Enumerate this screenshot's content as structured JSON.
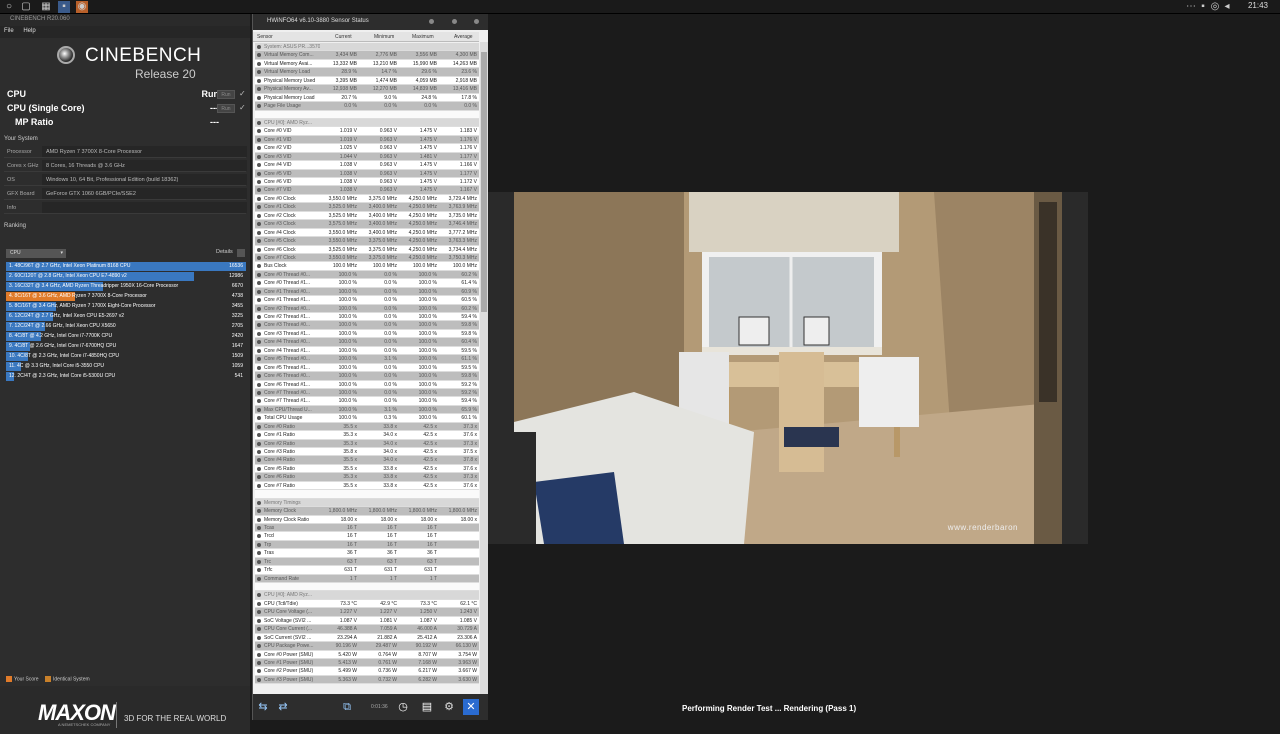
{
  "taskbar": {
    "time": "21:43"
  },
  "cinebench": {
    "window_title": "CINEBENCH R20.060",
    "menu": [
      "File",
      "Help"
    ],
    "logo_word": "CINEBENCH",
    "release": "Release 20",
    "tests": [
      {
        "label": "CPU",
        "value": "Run",
        "button": "Run"
      },
      {
        "label": "CPU (Single Core)",
        "value": "---",
        "button": "Run"
      },
      {
        "label": "MP Ratio",
        "value": "---"
      }
    ],
    "your_system_title": "Your System",
    "system": [
      {
        "key": "Processor",
        "value": "AMD Ryzen 7 3700X 8-Core Processor"
      },
      {
        "key": "Cores x GHz",
        "value": "8 Cores, 16 Threads @ 3.6 GHz"
      },
      {
        "key": "OS",
        "value": "Windows 10, 64 Bit, Professional Edition (build 18362)"
      },
      {
        "key": "GFX Board",
        "value": "GeForce GTX 1060 6GB/PCIe/SSE2"
      },
      {
        "key": "Info",
        "value": ""
      }
    ],
    "ranking_title": "Ranking",
    "ranking_select": "CPU",
    "details_label": "Details",
    "ranking": [
      {
        "label": "1. 48C/96T @ 2.7 GHz, Intel Xeon Platinum 8168 CPU",
        "score": "16536",
        "pct": 1.0,
        "kind": "other"
      },
      {
        "label": "2. 60C/120T @ 2.8 GHz, Intel Xeon CPU E7-4890 v2",
        "score": "12986",
        "pct": 0.785,
        "kind": "other"
      },
      {
        "label": "3. 16C/32T @ 3.4 GHz, AMD Ryzen Threadripper 1950X 16-Core Processor",
        "score": "6670",
        "pct": 0.403,
        "kind": "other"
      },
      {
        "label": "4. 8C/16T @ 3.6 GHz, AMD Ryzen 7 3700X 8-Core Processor",
        "score": "4738",
        "pct": 0.287,
        "kind": "mine"
      },
      {
        "label": "5. 8C/16T @ 3.4 GHz, AMD Ryzen 7 1700X Eight-Core Processor",
        "score": "3455",
        "pct": 0.209,
        "kind": "other"
      },
      {
        "label": "6. 12C/24T @ 2.7 GHz, Intel Xeon CPU E5-2697 v2",
        "score": "3225",
        "pct": 0.195,
        "kind": "other"
      },
      {
        "label": "7. 12C/24T @ 2.66 GHz, Intel Xeon CPU X5650",
        "score": "2705",
        "pct": 0.164,
        "kind": "other"
      },
      {
        "label": "8. 4C/8T @ 4.2 GHz, Intel Core i7-7700K CPU",
        "score": "2420",
        "pct": 0.146,
        "kind": "other"
      },
      {
        "label": "9. 4C/8T @ 2.6 GHz, Intel Core i7-6700HQ CPU",
        "score": "1647",
        "pct": 0.1,
        "kind": "other"
      },
      {
        "label": "10. 4C/8T @ 2.3 GHz, Intel Core i7-4850HQ CPU",
        "score": "1509",
        "pct": 0.091,
        "kind": "other"
      },
      {
        "label": "11. 4C @ 3.3 GHz, Intel Core i5-3550 CPU",
        "score": "1059",
        "pct": 0.064,
        "kind": "other"
      },
      {
        "label": "12. 2C/4T @ 2.3 GHz, Intel Core i5-5300U CPU",
        "score": "541",
        "pct": 0.033,
        "kind": "other"
      }
    ],
    "legend": [
      "Your Score",
      "Identical System"
    ],
    "maxon": "MAXON",
    "maxon_sub": "A NEMETSCHEK COMPANY",
    "tagline": "3D FOR THE REAL WORLD",
    "colors": {
      "mine": "#e07b2a",
      "other": "#3a78c0",
      "identical": "#c8802a"
    }
  },
  "hwinfo": {
    "title": "HWiNFO64 v6.10-3880 Sensor Status",
    "columns": [
      "Sensor",
      "Current",
      "Minimum",
      "Maximum",
      "Average"
    ],
    "rows": [
      {
        "n": "System: ASUS PR...3570",
        "c": [
          "",
          "",
          "",
          ""
        ],
        "t": "grp"
      },
      {
        "n": "Virtual Memory Com...",
        "c": [
          "3,434 MB",
          "2,776 MB",
          "3,556 MB",
          "4,300 MB"
        ],
        "t": "alt"
      },
      {
        "n": "Virtual Memory Avai...",
        "c": [
          "13,332 MB",
          "13,210 MB",
          "15,990 MB",
          "14,263 MB"
        ]
      },
      {
        "n": "Virtual Memory Load",
        "c": [
          "28.9 %",
          "14.7 %",
          "29.6 %",
          "23.6 %"
        ],
        "t": "alt"
      },
      {
        "n": "Physical Memory Used",
        "c": [
          "3,395 MB",
          "1,474 MB",
          "4,059 MB",
          "2,918 MB"
        ]
      },
      {
        "n": "Physical Memory Av...",
        "c": [
          "12,938 MB",
          "12,270 MB",
          "14,839 MB",
          "13,416 MB"
        ],
        "t": "alt"
      },
      {
        "n": "Physical Memory Load",
        "c": [
          "20.7 %",
          "9.0 %",
          "24.8 %",
          "17.8 %"
        ]
      },
      {
        "n": "Page File Usage",
        "c": [
          "0.0 %",
          "0.0 %",
          "0.0 %",
          "0.0 %"
        ],
        "t": "alt"
      },
      {
        "n": "",
        "c": [
          "",
          "",
          "",
          ""
        ],
        "t": "gap"
      },
      {
        "n": "CPU [#0]: AMD Ryz...",
        "c": [
          "",
          "",
          "",
          ""
        ],
        "t": "grp"
      },
      {
        "n": "Core #0 VID",
        "c": [
          "1.019 V",
          "0.963 V",
          "1.475 V",
          "1.183 V"
        ]
      },
      {
        "n": "Core #1 VID",
        "c": [
          "1.019 V",
          "0.963 V",
          "1.475 V",
          "1.176 V"
        ],
        "t": "alt"
      },
      {
        "n": "Core #2 VID",
        "c": [
          "1.025 V",
          "0.963 V",
          "1.475 V",
          "1.176 V"
        ]
      },
      {
        "n": "Core #3 VID",
        "c": [
          "1.044 V",
          "0.963 V",
          "1.481 V",
          "1.177 V"
        ],
        "t": "alt"
      },
      {
        "n": "Core #4 VID",
        "c": [
          "1.038 V",
          "0.963 V",
          "1.475 V",
          "1.166 V"
        ]
      },
      {
        "n": "Core #5 VID",
        "c": [
          "1.038 V",
          "0.963 V",
          "1.475 V",
          "1.177 V"
        ],
        "t": "alt"
      },
      {
        "n": "Core #6 VID",
        "c": [
          "1.038 V",
          "0.963 V",
          "1.475 V",
          "1.172 V"
        ]
      },
      {
        "n": "Core #7 VID",
        "c": [
          "1.038 V",
          "0.963 V",
          "1.475 V",
          "1.167 V"
        ],
        "t": "alt"
      },
      {
        "n": "Core #0 Clock",
        "c": [
          "3,550.0 MHz",
          "3,375.0 MHz",
          "4,250.0 MHz",
          "3,729.4 MHz"
        ]
      },
      {
        "n": "Core #1 Clock",
        "c": [
          "3,525.0 MHz",
          "3,400.0 MHz",
          "4,250.0 MHz",
          "3,763.9 MHz"
        ],
        "t": "alt"
      },
      {
        "n": "Core #2 Clock",
        "c": [
          "3,525.0 MHz",
          "3,400.0 MHz",
          "4,250.0 MHz",
          "3,735.0 MHz"
        ]
      },
      {
        "n": "Core #3 Clock",
        "c": [
          "3,575.0 MHz",
          "3,400.0 MHz",
          "4,250.0 MHz",
          "3,746.4 MHz"
        ],
        "t": "alt"
      },
      {
        "n": "Core #4 Clock",
        "c": [
          "3,550.0 MHz",
          "3,400.0 MHz",
          "4,250.0 MHz",
          "3,777.2 MHz"
        ]
      },
      {
        "n": "Core #5 Clock",
        "c": [
          "3,550.0 MHz",
          "3,375.0 MHz",
          "4,250.0 MHz",
          "3,763.3 MHz"
        ],
        "t": "alt"
      },
      {
        "n": "Core #6 Clock",
        "c": [
          "3,525.0 MHz",
          "3,375.0 MHz",
          "4,250.0 MHz",
          "3,734.4 MHz"
        ]
      },
      {
        "n": "Core #7 Clock",
        "c": [
          "3,550.0 MHz",
          "3,375.0 MHz",
          "4,250.0 MHz",
          "3,750.3 MHz"
        ],
        "t": "alt"
      },
      {
        "n": "Bus Clock",
        "c": [
          "100.0 MHz",
          "100.0 MHz",
          "100.0 MHz",
          "100.0 MHz"
        ]
      },
      {
        "n": "Core #0 Thread #0...",
        "c": [
          "100.0 %",
          "0.0 %",
          "100.0 %",
          "60.2 %"
        ],
        "t": "alt"
      },
      {
        "n": "Core #0 Thread #1...",
        "c": [
          "100.0 %",
          "0.0 %",
          "100.0 %",
          "61.4 %"
        ]
      },
      {
        "n": "Core #1 Thread #0...",
        "c": [
          "100.0 %",
          "0.0 %",
          "100.0 %",
          "60.9 %"
        ],
        "t": "alt"
      },
      {
        "n": "Core #1 Thread #1...",
        "c": [
          "100.0 %",
          "0.0 %",
          "100.0 %",
          "60.5 %"
        ]
      },
      {
        "n": "Core #2 Thread #0...",
        "c": [
          "100.0 %",
          "0.0 %",
          "100.0 %",
          "60.2 %"
        ],
        "t": "alt"
      },
      {
        "n": "Core #2 Thread #1...",
        "c": [
          "100.0 %",
          "0.0 %",
          "100.0 %",
          "59.4 %"
        ]
      },
      {
        "n": "Core #3 Thread #0...",
        "c": [
          "100.0 %",
          "0.0 %",
          "100.0 %",
          "59.8 %"
        ],
        "t": "alt"
      },
      {
        "n": "Core #3 Thread #1...",
        "c": [
          "100.0 %",
          "0.0 %",
          "100.0 %",
          "59.8 %"
        ]
      },
      {
        "n": "Core #4 Thread #0...",
        "c": [
          "100.0 %",
          "0.0 %",
          "100.0 %",
          "60.4 %"
        ],
        "t": "alt"
      },
      {
        "n": "Core #4 Thread #1...",
        "c": [
          "100.0 %",
          "0.0 %",
          "100.0 %",
          "59.5 %"
        ]
      },
      {
        "n": "Core #5 Thread #0...",
        "c": [
          "100.0 %",
          "3.1 %",
          "100.0 %",
          "61.1 %"
        ],
        "t": "alt"
      },
      {
        "n": "Core #5 Thread #1...",
        "c": [
          "100.0 %",
          "0.0 %",
          "100.0 %",
          "59.5 %"
        ]
      },
      {
        "n": "Core #6 Thread #0...",
        "c": [
          "100.0 %",
          "0.0 %",
          "100.0 %",
          "59.8 %"
        ],
        "t": "alt"
      },
      {
        "n": "Core #6 Thread #1...",
        "c": [
          "100.0 %",
          "0.0 %",
          "100.0 %",
          "59.2 %"
        ]
      },
      {
        "n": "Core #7 Thread #0...",
        "c": [
          "100.0 %",
          "0.0 %",
          "100.0 %",
          "59.2 %"
        ],
        "t": "alt"
      },
      {
        "n": "Core #7 Thread #1...",
        "c": [
          "100.0 %",
          "0.0 %",
          "100.0 %",
          "59.4 %"
        ]
      },
      {
        "n": "Max CPU/Thread U...",
        "c": [
          "100.0 %",
          "3.1 %",
          "100.0 %",
          "65.9 %"
        ],
        "t": "alt"
      },
      {
        "n": "Total CPU Usage",
        "c": [
          "100.0 %",
          "0.3 %",
          "100.0 %",
          "60.1 %"
        ]
      },
      {
        "n": "Core #0 Ratio",
        "c": [
          "35.5 x",
          "33.8 x",
          "42.5 x",
          "37.3 x"
        ],
        "t": "alt"
      },
      {
        "n": "Core #1 Ratio",
        "c": [
          "35.3 x",
          "34.0 x",
          "42.5 x",
          "37.6 x"
        ]
      },
      {
        "n": "Core #2 Ratio",
        "c": [
          "35.3 x",
          "34.0 x",
          "42.5 x",
          "37.3 x"
        ],
        "t": "alt"
      },
      {
        "n": "Core #3 Ratio",
        "c": [
          "35.8 x",
          "34.0 x",
          "42.5 x",
          "37.5 x"
        ]
      },
      {
        "n": "Core #4 Ratio",
        "c": [
          "35.5 x",
          "34.0 x",
          "42.5 x",
          "37.8 x"
        ],
        "t": "alt"
      },
      {
        "n": "Core #5 Ratio",
        "c": [
          "35.5 x",
          "33.8 x",
          "42.5 x",
          "37.6 x"
        ]
      },
      {
        "n": "Core #6 Ratio",
        "c": [
          "35.3 x",
          "33.8 x",
          "42.5 x",
          "37.3 x"
        ],
        "t": "alt"
      },
      {
        "n": "Core #7 Ratio",
        "c": [
          "35.5 x",
          "33.8 x",
          "42.5 x",
          "37.6 x"
        ]
      },
      {
        "n": "",
        "c": [
          "",
          "",
          "",
          ""
        ],
        "t": "gap"
      },
      {
        "n": "Memory Timings",
        "c": [
          "",
          "",
          "",
          ""
        ],
        "t": "grp"
      },
      {
        "n": "Memory Clock",
        "c": [
          "1,800.0 MHz",
          "1,800.0 MHz",
          "1,800.0 MHz",
          "1,800.0 MHz"
        ],
        "t": "alt"
      },
      {
        "n": "Memory Clock Ratio",
        "c": [
          "18.00 x",
          "18.00 x",
          "18.00 x",
          "18.00 x"
        ]
      },
      {
        "n": "Tcas",
        "c": [
          "16 T",
          "16 T",
          "16 T",
          ""
        ],
        "t": "alt"
      },
      {
        "n": "Trcd",
        "c": [
          "16 T",
          "16 T",
          "16 T",
          ""
        ]
      },
      {
        "n": "Trp",
        "c": [
          "16 T",
          "16 T",
          "16 T",
          ""
        ],
        "t": "alt"
      },
      {
        "n": "Tras",
        "c": [
          "36 T",
          "36 T",
          "36 T",
          ""
        ]
      },
      {
        "n": "Trc",
        "c": [
          "63 T",
          "63 T",
          "63 T",
          ""
        ],
        "t": "alt"
      },
      {
        "n": "Trfc",
        "c": [
          "631 T",
          "631 T",
          "631 T",
          ""
        ]
      },
      {
        "n": "Command Rate",
        "c": [
          "1 T",
          "1 T",
          "1 T",
          ""
        ],
        "t": "alt"
      },
      {
        "n": "",
        "c": [
          "",
          "",
          "",
          ""
        ],
        "t": "gap"
      },
      {
        "n": "CPU [#0]: AMD Ryz...",
        "c": [
          "",
          "",
          "",
          ""
        ],
        "t": "grp"
      },
      {
        "n": "CPU (Tctl/Tdie)",
        "c": [
          "73.3 °C",
          "42.9 °C",
          "73.3 °C",
          "62.1 °C"
        ]
      },
      {
        "n": "CPU Core Voltage (...",
        "c": [
          "1.227 V",
          "1.227 V",
          "1.250 V",
          "1.243 V"
        ],
        "t": "alt"
      },
      {
        "n": "SoC Voltage (SVI2 ...",
        "c": [
          "1.087 V",
          "1.081 V",
          "1.087 V",
          "1.085 V"
        ]
      },
      {
        "n": "CPU Core Current (...",
        "c": [
          "46.388 A",
          "7.059 A",
          "46.000 A",
          "30.729 A"
        ],
        "t": "alt"
      },
      {
        "n": "SoC Current (SVI2 ...",
        "c": [
          "23.294 A",
          "21.882 A",
          "25.412 A",
          "23.306 A"
        ]
      },
      {
        "n": "CPU Package Powe...",
        "c": [
          "90.196 W",
          "29.487 W",
          "90.192 W",
          "66.130 W"
        ],
        "t": "alt"
      },
      {
        "n": "Core #0 Power (SMU)",
        "c": [
          "5.420 W",
          "0.764 W",
          "8.707 W",
          "3.754 W"
        ]
      },
      {
        "n": "Core #1 Power (SMU)",
        "c": [
          "5.413 W",
          "0.761 W",
          "7.168 W",
          "3.963 W"
        ],
        "t": "alt"
      },
      {
        "n": "Core #2 Power (SMU)",
        "c": [
          "5.499 W",
          "0.736 W",
          "6.217 W",
          "3.667 W"
        ]
      },
      {
        "n": "Core #3 Power (SMU)",
        "c": [
          "5.363 W",
          "0.732 W",
          "6.282 W",
          "3.630 W"
        ],
        "t": "alt"
      }
    ],
    "timer": "0:01:36"
  },
  "render": {
    "watermark": "www.renderbaron",
    "status": "Performing Render Test ... Rendering (Pass 1)"
  }
}
